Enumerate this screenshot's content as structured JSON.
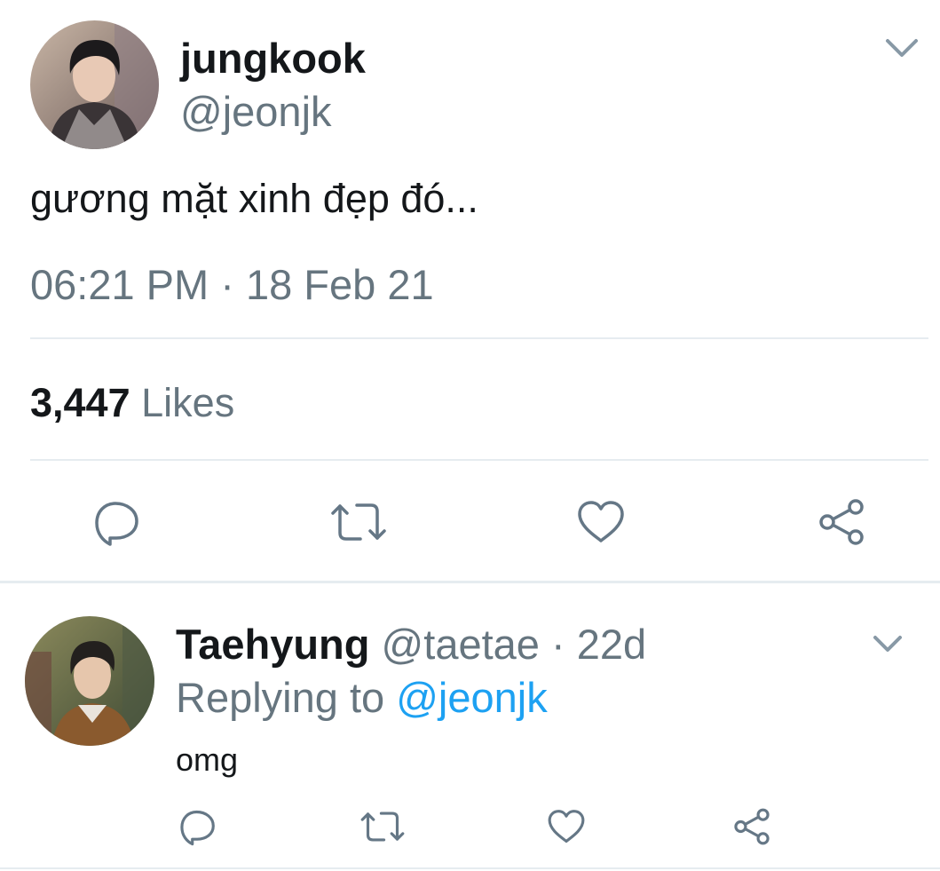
{
  "main_tweet": {
    "display_name": "jungkook",
    "handle": "@jeonjk",
    "text": "gương mặt xinh đẹp đó...",
    "timestamp": "06:21 PM · 18 Feb 21",
    "likes_count": "3,447",
    "likes_label": "Likes"
  },
  "reply": {
    "display_name": "Taehyung",
    "handle": "@taetae",
    "time": "· 22d",
    "replying_prefix": "Replying to",
    "replying_handle": "@jeonjk",
    "text": "omg"
  },
  "colors": {
    "muted": "#66757f",
    "link": "#1da1f2",
    "divider": "#e6ecf0"
  },
  "icons": [
    "chevron-down-icon",
    "reply-icon",
    "retweet-icon",
    "heart-icon",
    "share-icon"
  ]
}
